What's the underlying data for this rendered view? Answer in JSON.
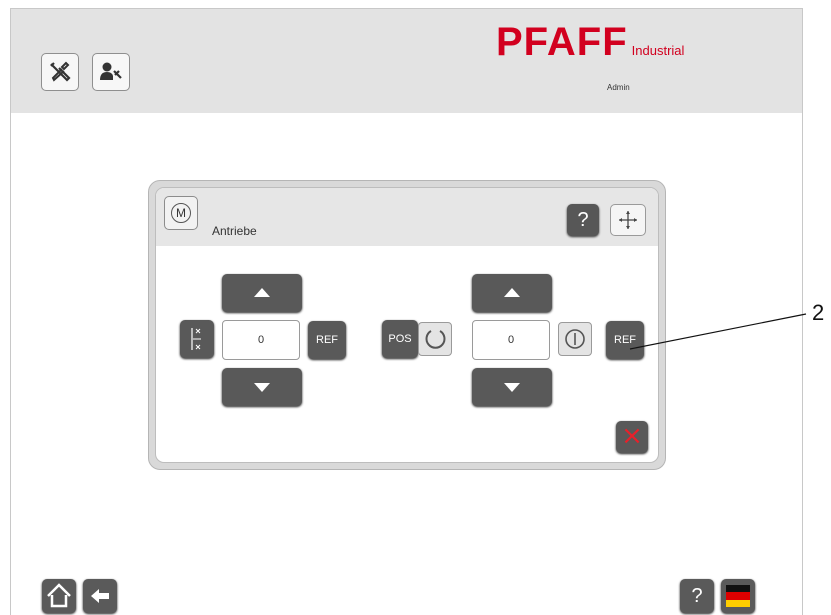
{
  "header": {
    "logo_main": "PFAFF",
    "logo_sub": "Industrial",
    "user": "Admin"
  },
  "toolbar": {
    "icons": [
      "tools-icon",
      "user-settings-icon"
    ]
  },
  "dialog": {
    "title": "Antriebe",
    "mode_icon_label": "M",
    "help_label": "?",
    "left_drive": {
      "value": "0",
      "ref_label": "REF"
    },
    "right_drive": {
      "pos_label": "POS",
      "value": "0",
      "ref_label": "REF"
    },
    "close_label": "×"
  },
  "footer": {
    "help_label": "?",
    "language": "de"
  },
  "callout": {
    "number": "2"
  },
  "colors": {
    "brand_red": "#d2001f",
    "button_dark": "#595959",
    "header_gray": "#e3e3e3",
    "close_red": "#e8202a"
  }
}
